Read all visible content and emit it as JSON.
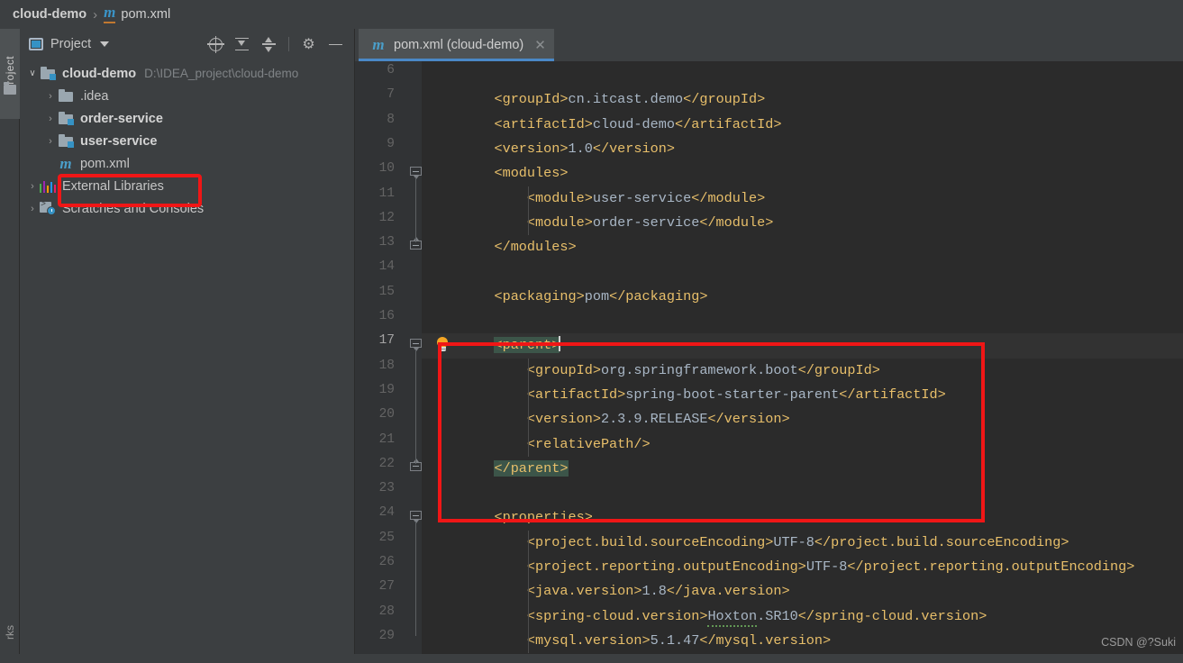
{
  "breadcrumb": {
    "project": "cloud-demo",
    "separator": "›",
    "module_icon": "maven-m-icon",
    "file": "pom.xml"
  },
  "toolstrip": {
    "project_tab": "Project",
    "folder_icon": "folder-icon",
    "bottom_tab": "rks"
  },
  "project_panel": {
    "title": "Project",
    "title_icon": "project-view-icon",
    "caret_icon": "chevron-down-icon",
    "actions": [
      {
        "name": "locate-icon",
        "label": "Select Opened File"
      },
      {
        "name": "expand-all-icon",
        "label": "Expand All"
      },
      {
        "name": "collapse-all-icon",
        "label": "Collapse All"
      },
      {
        "name": "gear-icon",
        "label": "Settings",
        "glyph": "⚙"
      },
      {
        "name": "minimize-icon",
        "label": "Hide"
      }
    ],
    "tree": [
      {
        "arrow": "⌄",
        "expanded": true,
        "icon": "module-folder-icon",
        "label": "cloud-demo",
        "bold": true,
        "path": "D:\\IDEA_project\\cloud-demo",
        "indent": 0
      },
      {
        "arrow": "›",
        "expanded": false,
        "icon": "folder-icon",
        "label": ".idea",
        "bold": false,
        "path": "",
        "indent": 1
      },
      {
        "arrow": "›",
        "expanded": false,
        "icon": "module-folder-icon",
        "label": "order-service",
        "bold": true,
        "path": "",
        "indent": 1
      },
      {
        "arrow": "›",
        "expanded": false,
        "icon": "module-folder-icon",
        "label": "user-service",
        "bold": true,
        "path": "",
        "indent": 1
      },
      {
        "arrow": "",
        "expanded": false,
        "icon": "maven-m-icon",
        "label": "pom.xml",
        "bold": false,
        "path": "",
        "indent": 1
      },
      {
        "arrow": "›",
        "expanded": false,
        "icon": "external-libraries-icon",
        "label": "External Libraries",
        "bold": false,
        "path": "",
        "indent": 0
      },
      {
        "arrow": "›",
        "expanded": false,
        "icon": "scratches-icon",
        "label": "Scratches and Consoles",
        "bold": false,
        "path": "",
        "indent": 0
      }
    ]
  },
  "editor": {
    "tab": {
      "icon": "maven-m-icon",
      "label": "pom.xml (cloud-demo)",
      "close_icon": "close-icon",
      "active": true
    },
    "current_line": 17,
    "first_line": 6,
    "lines": [
      {
        "n": 6,
        "indent": 0,
        "text": ""
      },
      {
        "n": 7,
        "indent": 1,
        "html": "<span class=\"tag\">&lt;groupId&gt;</span><span class=\"val\">cn.itcast.demo</span><span class=\"tag\">&lt;/groupId&gt;</span>"
      },
      {
        "n": 8,
        "indent": 1,
        "html": "<span class=\"tag\">&lt;artifactId&gt;</span><span class=\"val\">cloud-demo</span><span class=\"tag\">&lt;/artifactId&gt;</span>"
      },
      {
        "n": 9,
        "indent": 1,
        "html": "<span class=\"tag\">&lt;version&gt;</span><span class=\"val\">1.0</span><span class=\"tag\">&lt;/version&gt;</span>"
      },
      {
        "n": 10,
        "indent": 1,
        "html": "<span class=\"tag\">&lt;modules&gt;</span>",
        "fold": "open"
      },
      {
        "n": 11,
        "indent": 2,
        "html": "<span class=\"tag\">&lt;module&gt;</span><span class=\"val\">user-service</span><span class=\"tag\">&lt;/module&gt;</span>"
      },
      {
        "n": 12,
        "indent": 2,
        "html": "<span class=\"tag\">&lt;module&gt;</span><span class=\"val\">order-service</span><span class=\"tag\">&lt;/module&gt;</span>"
      },
      {
        "n": 13,
        "indent": 1,
        "html": "<span class=\"tag\">&lt;/modules&gt;</span>",
        "fold": "close"
      },
      {
        "n": 14,
        "indent": 0,
        "text": ""
      },
      {
        "n": 15,
        "indent": 1,
        "html": "<span class=\"tag\">&lt;packaging&gt;</span><span class=\"val\">pom</span><span class=\"tag\">&lt;/packaging&gt;</span>"
      },
      {
        "n": 16,
        "indent": 0,
        "text": ""
      },
      {
        "n": 17,
        "indent": 1,
        "html": "<span class=\"tag hl\">&lt;parent&gt;</span><span class=\"caret\"></span>",
        "fold": "open",
        "bulb": true,
        "current": true
      },
      {
        "n": 18,
        "indent": 2,
        "html": "<span class=\"tag\">&lt;groupId&gt;</span><span class=\"val\">org.springframework.boot</span><span class=\"tag\">&lt;/groupId&gt;</span>"
      },
      {
        "n": 19,
        "indent": 2,
        "html": "<span class=\"tag\">&lt;artifactId&gt;</span><span class=\"val\">spring-boot-starter-parent</span><span class=\"tag\">&lt;/artifactId&gt;</span>"
      },
      {
        "n": 20,
        "indent": 2,
        "html": "<span class=\"tag\">&lt;version&gt;</span><span class=\"val\">2.3.9.RELEASE</span><span class=\"tag\">&lt;/version&gt;</span>"
      },
      {
        "n": 21,
        "indent": 2,
        "html": "<span class=\"tag\">&lt;relativePath/&gt;</span>"
      },
      {
        "n": 22,
        "indent": 1,
        "html": "<span class=\"tag hl\">&lt;/parent&gt;</span>",
        "fold": "close"
      },
      {
        "n": 23,
        "indent": 0,
        "text": ""
      },
      {
        "n": 24,
        "indent": 1,
        "html": "<span class=\"tag\">&lt;properties&gt;</span>",
        "fold": "open"
      },
      {
        "n": 25,
        "indent": 2,
        "html": "<span class=\"tag\">&lt;project.build.sourceEncoding&gt;</span><span class=\"val\">UTF-8</span><span class=\"tag\">&lt;/project.build.sourceEncoding&gt;</span>"
      },
      {
        "n": 26,
        "indent": 2,
        "html": "<span class=\"tag\">&lt;project.reporting.outputEncoding&gt;</span><span class=\"val\">UTF-8</span><span class=\"tag\">&lt;/project.reporting.outputEncoding&gt;</span>"
      },
      {
        "n": 27,
        "indent": 2,
        "html": "<span class=\"tag\">&lt;java.version&gt;</span><span class=\"val\">1.8</span><span class=\"tag\">&lt;/java.version&gt;</span>"
      },
      {
        "n": 28,
        "indent": 2,
        "html": "<span class=\"tag\">&lt;spring-cloud.version&gt;</span><span class=\"val typo\">Hoxton</span><span class=\"val\">.SR10</span><span class=\"tag\">&lt;/spring-cloud.version&gt;</span>"
      },
      {
        "n": 29,
        "indent": 2,
        "html": "<span class=\"tag\">&lt;mysql.version&gt;</span><span class=\"val\">5.1.47</span><span class=\"tag\">&lt;/mysql.version&gt;</span>"
      }
    ]
  },
  "annotations": {
    "tree_highlight": {
      "name": "red-highlight-box-pom-xml",
      "color": "#f01616"
    },
    "code_highlight": {
      "name": "red-highlight-box-parent-block",
      "color": "#f01616"
    }
  },
  "watermark": "CSDN @?Suki",
  "colors": {
    "panel_bg": "#3c3f41",
    "editor_bg": "#2b2b2b",
    "gutter_bg": "#313335",
    "tag": "#e8bf6a",
    "value": "#a9b7c6",
    "accent": "#3592c4",
    "highlight_red": "#f01616",
    "tag_pair_highlight": "#3c5549"
  }
}
